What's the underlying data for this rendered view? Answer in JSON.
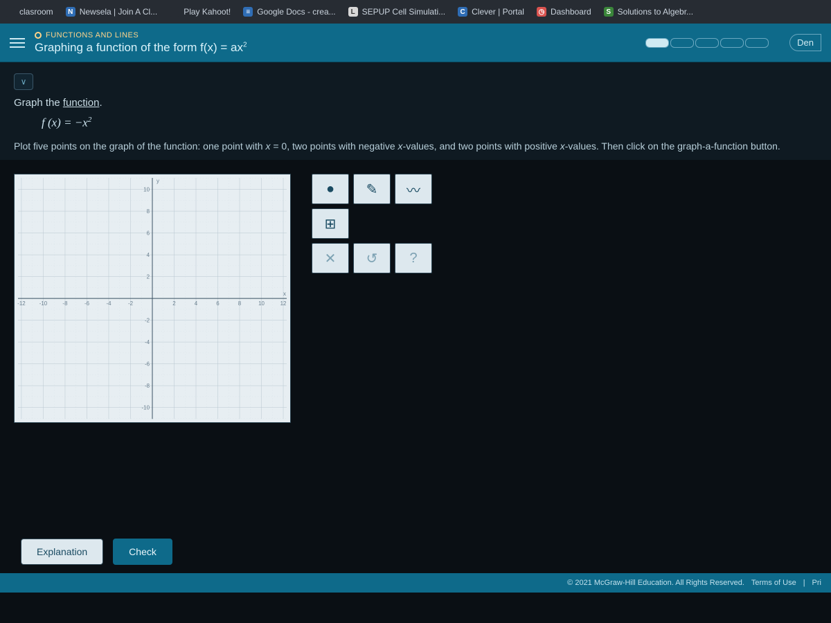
{
  "bookmarks": [
    {
      "icon": "",
      "iconBg": "#272c33",
      "label": "clasroom"
    },
    {
      "icon": "N",
      "iconBg": "#2f6db5",
      "label": "Newsela | Join A Cl..."
    },
    {
      "icon": "",
      "iconBg": "#272c33",
      "label": "Play Kahoot!"
    },
    {
      "icon": "≡",
      "iconBg": "#2f6db5",
      "label": "Google Docs - crea..."
    },
    {
      "icon": "L",
      "iconBg": "#d8d8d8",
      "label": "SEPUP Cell Simulati..."
    },
    {
      "icon": "C",
      "iconBg": "#2f6db5",
      "label": "Clever | Portal"
    },
    {
      "icon": "◷",
      "iconBg": "#d9534f",
      "label": "Dashboard"
    },
    {
      "icon": "S",
      "iconBg": "#3a863a",
      "label": "Solutions to Algebr..."
    }
  ],
  "header": {
    "category": "FUNCTIONS AND LINES",
    "title_pre": "Graphing a function of the form f(x) = ax",
    "title_sup": "2",
    "den_label": "Den"
  },
  "problem": {
    "chevron": "∨",
    "prompt_pre": "Graph the ",
    "prompt_link": "function",
    "prompt_post": ".",
    "fn_pre": "f (x) = −x",
    "fn_sup": "2",
    "instr_a": "Plot five points on the graph of the function: one point with ",
    "instr_x": "x",
    "instr_b": " = 0, two points with negative ",
    "instr_c": "-values, and two points with positive ",
    "instr_d": "-values. Then click on the graph-a-function button."
  },
  "axis": {
    "range": [
      -12,
      -10,
      -8,
      -6,
      -4,
      -2,
      2,
      4,
      6,
      8,
      10,
      12
    ]
  },
  "tools": {
    "point": "●",
    "pencil": "✎",
    "curve": "〰",
    "graphfn": "⊞",
    "clear": "✕",
    "undo": "↺",
    "help": "?"
  },
  "buttons": {
    "explanation": "Explanation",
    "check": "Check"
  },
  "footer": {
    "copyright": "© 2021 McGraw-Hill Education. All Rights Reserved.",
    "terms": "Terms of Use",
    "sep": "|",
    "priv": "Pri"
  },
  "chart_data": {
    "type": "scatter",
    "title": "",
    "xlabel": "x",
    "ylabel": "y",
    "xlim": [
      -12,
      12
    ],
    "ylim": [
      -12,
      12
    ],
    "series": []
  }
}
